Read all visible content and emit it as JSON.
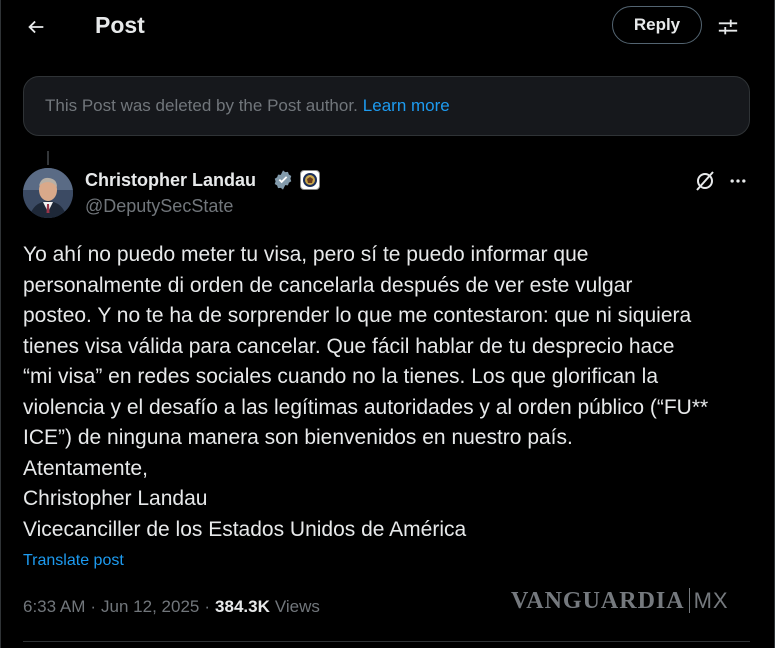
{
  "header": {
    "title": "Post",
    "reply_label": "Reply",
    "back_icon": "arrow-left-icon",
    "settings_icon": "sliders-icon"
  },
  "notice": {
    "text": "This Post was deleted by the Post author.",
    "link": "Learn more"
  },
  "author": {
    "name": "Christopher Landau",
    "handle": "@DeputySecState",
    "verified": true,
    "affiliation_badge": "government-seal-icon"
  },
  "post": {
    "lines": [
      "Yo ahí no puedo meter tu visa, pero sí te puedo informar que",
      "personalmente di orden de cancelarla después de ver este vulgar",
      "posteo. Y no te ha de sorprender lo que me contestaron: que ni siquiera",
      "tienes visa válida para cancelar. Que fácil hablar de tu desprecio hace",
      "“mi visa” en redes sociales cuando no la tienes. Los que glorifican la",
      "violencia y el desafío a las legítimas autoridades y al orden público (“FU**",
      "ICE”) de ninguna manera son bienvenidos en nuestro país.",
      "Atentamente,",
      "Christopher Landau",
      "Vicecanciller de los Estados Unidos de América"
    ],
    "translate_label": "Translate post"
  },
  "meta": {
    "time": "6:33 AM",
    "date": "Jun 12, 2025",
    "views_count": "384.3K",
    "views_label": "Views"
  },
  "watermark": {
    "brand": "VANGUARDIA",
    "suffix": "MX"
  },
  "colors": {
    "background": "#000000",
    "text": "#e7e9ea",
    "muted": "#71767b",
    "accent": "#1d9bf0",
    "border": "#2f3336"
  }
}
